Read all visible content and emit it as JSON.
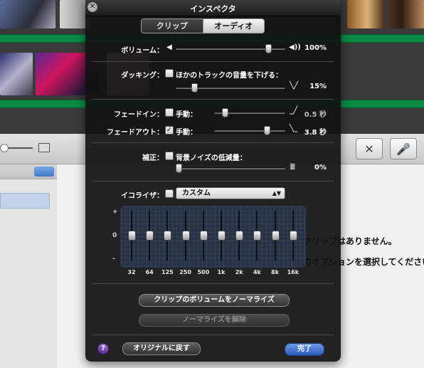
{
  "inspector": {
    "title": "インスペクタ",
    "tabs": [
      {
        "label": "クリップ",
        "selected": false
      },
      {
        "label": "オーディオ",
        "selected": true
      }
    ],
    "volume": {
      "label": "ボリューム：",
      "value": "100%",
      "level": 0.86
    },
    "ducking": {
      "label": "ダッキング：",
      "checkbox_label": "ほかのトラックの音量を下げる：",
      "checked": false,
      "value": "15%",
      "level": 0.15
    },
    "fade_in": {
      "label": "フェードイン：",
      "manual_label": "手動：",
      "checked": false,
      "value": "0.5 秒",
      "level": 0.12
    },
    "fade_out": {
      "label": "フェードアウト：",
      "manual_label": "手動：",
      "checked": true,
      "value": "3.8 秒",
      "level": 0.76
    },
    "enhance": {
      "label": "補正：",
      "checkbox_label": "背景ノイズの低減量：",
      "checked": false,
      "value": "0%",
      "level": 0.0
    },
    "equalizer": {
      "label": "イコライザ：",
      "checked": false,
      "preset": "カスタム",
      "axis_labels": [
        "+",
        "0",
        "-"
      ],
      "bands": [
        {
          "freq": "32",
          "gain": 0
        },
        {
          "freq": "64",
          "gain": 0
        },
        {
          "freq": "125",
          "gain": 0
        },
        {
          "freq": "250",
          "gain": 0
        },
        {
          "freq": "500",
          "gain": 0
        },
        {
          "freq": "1k",
          "gain": 0
        },
        {
          "freq": "2k",
          "gain": 0
        },
        {
          "freq": "4k",
          "gain": 0
        },
        {
          "freq": "8k",
          "gain": 0
        },
        {
          "freq": "16k",
          "gain": 0
        }
      ]
    },
    "normalize_button": "クリップのボリュームをノーマライズ",
    "remove_normalize_button": "ノーマライズを解除",
    "revert_button": "オリジナルに戻す",
    "done_button": "完了",
    "help_label": "?"
  },
  "background": {
    "message1": "クリップはありません。",
    "message2": "のオプションを選択してください"
  },
  "colors": {
    "panel_bg": "#121212",
    "timeline_green": "#0a8a45",
    "done_button": "#2a5bbd",
    "help_button": "#7a45b8",
    "eq_bg": "#283245"
  }
}
